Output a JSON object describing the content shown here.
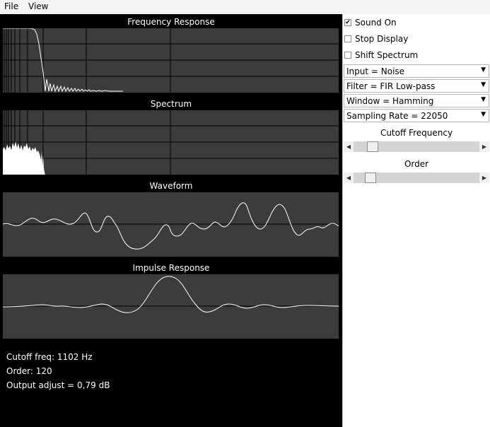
{
  "menu": {
    "file": "File",
    "view": "View"
  },
  "plots": {
    "frequency_response": "Frequency Response",
    "spectrum": "Spectrum",
    "waveform": "Waveform",
    "impulse_response": "Impulse Response"
  },
  "info": {
    "cutoff": "Cutoff freq: 1102 Hz",
    "order": "Order: 120",
    "output_adjust": "Output adjust = 0,79 dB"
  },
  "controls": {
    "sound_on": {
      "label": "Sound On",
      "checked": true,
      "mark": "✔"
    },
    "stop_display": {
      "label": "Stop Display",
      "checked": false
    },
    "shift_spectrum": {
      "label": "Shift Spectrum",
      "checked": false
    },
    "input": "Input = Noise",
    "filter": "Filter = FIR Low-pass",
    "window": "Window = Hamming",
    "sampling_rate": "Sampling Rate = 22050",
    "cutoff_label": "Cutoff Frequency",
    "order_label": "Order",
    "cutoff_slider_level": 0.12,
    "order_slider_level": 0.1,
    "arrow_down": "▼",
    "arrow_left": "◀",
    "arrow_right": "▶"
  },
  "colors": {
    "canvas_bg": "#000000",
    "plot_bg": "#3c3c3c",
    "trace": "#ffffff",
    "grid": "#000000"
  }
}
